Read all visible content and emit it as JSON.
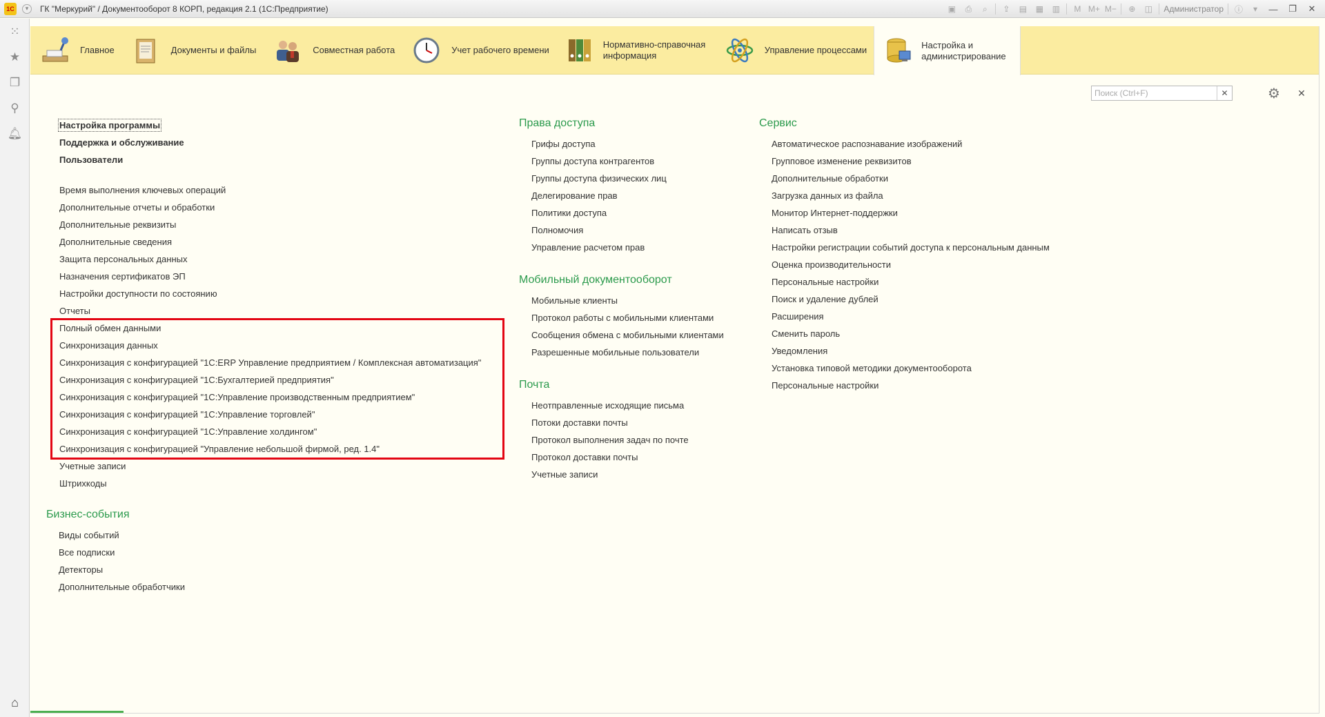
{
  "window": {
    "title": "ГК \"Меркурий\" / Документооборот 8 КОРП, редакция 2.1  (1С:Предприятие)",
    "logo_text": "1С",
    "user": "Администратор"
  },
  "sections": [
    {
      "label": "Главное",
      "icon": "desk-lamp-icon"
    },
    {
      "label": "Документы и файлы",
      "icon": "document-folder-icon"
    },
    {
      "label": "Совместная работа",
      "icon": "people-icon"
    },
    {
      "label": "Учет рабочего времени",
      "icon": "clock-icon"
    },
    {
      "label": "Нормативно-справочная информация",
      "icon": "binders-icon"
    },
    {
      "label": "Управление процессами",
      "icon": "process-atom-icon"
    },
    {
      "label": "Настройка и администрирование",
      "icon": "database-admin-icon",
      "active": true
    }
  ],
  "search": {
    "placeholder": "Поиск (Ctrl+F)",
    "value": ""
  },
  "colors": {
    "accent_green": "#2b9a4c",
    "section_bar": "#fbeca0",
    "highlight_red": "#e30613",
    "background": "#fffef4"
  },
  "column1": {
    "top_links": [
      "Настройка программы",
      "Поддержка и обслуживание",
      "Пользователи"
    ],
    "links": [
      "Время выполнения ключевых операций",
      "Дополнительные отчеты и обработки",
      "Дополнительные реквизиты",
      "Дополнительные сведения",
      "Защита персональных данных",
      "Назначения сертификатов ЭП",
      "Настройки доступности по состоянию",
      "Отчеты",
      "Полный обмен данными",
      "Синхронизация данных",
      "Синхронизация с конфигурацией \"1С:ERP Управление предприятием / Комплексная автоматизация\"",
      "Синхронизация с конфигурацией \"1С:Бухгалтерией предприятия\"",
      "Синхронизация с конфигурацией \"1С:Управление производственным предприятием\"",
      "Синхронизация с конфигурацией \"1С:Управление торговлей\"",
      "Синхронизация с конфигурацией \"1С:Управление холдингом\"",
      "Синхронизация с конфигурацией \"Управление небольшой фирмой, ред. 1.4\"",
      "Учетные записи",
      "Штрихкоды"
    ],
    "business_events": {
      "title": "Бизнес-события",
      "links": [
        "Виды событий",
        "Все подписки",
        "Детекторы",
        "Дополнительные обработчики"
      ]
    }
  },
  "column2": {
    "groups": [
      {
        "title": "Права доступа",
        "links": [
          "Грифы доступа",
          "Группы доступа контрагентов",
          "Группы доступа физических лиц",
          "Делегирование прав",
          "Политики доступа",
          "Полномочия",
          "Управление расчетом прав"
        ]
      },
      {
        "title": "Мобильный документооборот",
        "links": [
          "Мобильные клиенты",
          "Протокол работы с мобильными клиентами",
          "Сообщения обмена с мобильными клиентами",
          "Разрешенные мобильные пользователи"
        ]
      },
      {
        "title": "Почта",
        "links": [
          "Неотправленные исходящие письма",
          "Потоки доставки почты",
          "Протокол выполнения задач по почте",
          "Протокол доставки почты",
          "Учетные записи"
        ]
      }
    ]
  },
  "column3": {
    "title": "Сервис",
    "links": [
      "Автоматическое распознавание изображений",
      "Групповое изменение реквизитов",
      "Дополнительные обработки",
      "Загрузка данных из файла",
      "Монитор Интернет-поддержки",
      "Написать отзыв",
      "Настройки регистрации событий доступа к персональным данным",
      "Оценка производительности",
      "Персональные настройки",
      "Поиск и удаление дублей",
      "Расширения",
      "Сменить пароль",
      "Уведомления",
      "Установка типовой методики документооборота",
      "Персональные настройки"
    ]
  }
}
